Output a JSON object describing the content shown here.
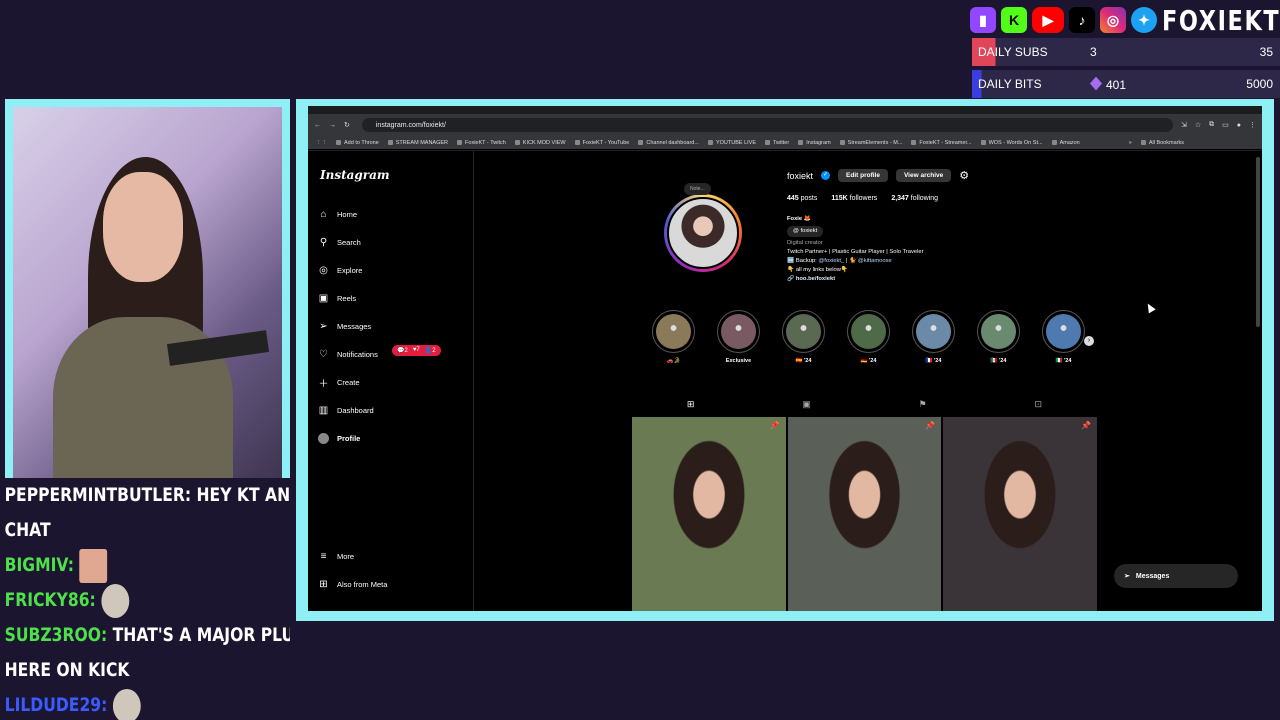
{
  "overlay": {
    "brand": "FOXIEKT",
    "social_icons": [
      "twitch-icon",
      "kick-icon",
      "youtube-icon",
      "tiktok-icon",
      "instagram-icon",
      "twitter-icon"
    ],
    "goals": {
      "subs": {
        "label": "DAILY SUBS",
        "current": "3",
        "target": "35",
        "progress": 0.0857,
        "color": "#e0455a"
      },
      "bits": {
        "label": "DAILY BITS",
        "current": "401",
        "target": "5000",
        "progress": 0.0802,
        "color": "#3c3de0"
      }
    }
  },
  "chat": {
    "lines": [
      {
        "name": "",
        "text": "PEPPERMINTBUTLER: HEY KT AND"
      },
      {
        "name": "",
        "text": "CHAT"
      },
      {
        "name": "BIGMIV:",
        "text": ""
      },
      {
        "name": "FRICKY86:",
        "text": ""
      },
      {
        "name": "SUBZ3ROO:",
        "text": "THAT'S A MAJOR PLUS"
      },
      {
        "name": "",
        "text": "HERE ON KICK"
      },
      {
        "name": "LILDUDE29:",
        "text": ""
      }
    ]
  },
  "browser": {
    "url": "instagram.com/foxiekt/",
    "bookmarks": [
      "Add to Throne",
      "STREAM MANAGER",
      "FoxieKT - Twitch",
      "KICK MOD VIEW",
      "FoxieKT - YouTube",
      "Channel dashboard...",
      "YOUTUBE LIVE",
      "Twitter",
      "Instagram",
      "StreamElements - M...",
      "FoxieKT - Streamer...",
      "WOS - Words On St...",
      "Amazon"
    ],
    "all_bookmarks": "All Bookmarks"
  },
  "instagram": {
    "logo": "Instagram",
    "nav": {
      "home": "Home",
      "search": "Search",
      "explore": "Explore",
      "reels": "Reels",
      "messages": "Messages",
      "notifications": "Notifications",
      "create": "Create",
      "dashboard": "Dashboard",
      "profile": "Profile",
      "more": "More",
      "also_from_meta": "Also from Meta"
    },
    "notif_badge": {
      "comments": "2",
      "likes": "7",
      "follows": "2"
    },
    "profile": {
      "username": "foxiekt",
      "edit_profile": "Edit profile",
      "view_archive": "View archive",
      "note": "Note...",
      "posts": "445",
      "posts_label": "posts",
      "followers": "115K",
      "followers_label": "followers",
      "following": "2,347",
      "following_label": "following",
      "name": "Foxie 🦊",
      "threads_handle": "foxiekt",
      "category": "Digital creator",
      "bio_line1": "Twitch Partner+ | Plastic Guitar Player | Solo Traveler",
      "bio_line2_prefix": "🆕 Backup: ",
      "bio_line2_handle1": "@foxiekt_",
      "bio_line2_mid": " | 🐈 ",
      "bio_line2_handle2": "@kittamoose",
      "bio_line3": "👇 all my links below👇",
      "link": "hoo.be/foxiekt"
    },
    "highlights": [
      {
        "label": "🚗🐊",
        "color": "#8a7a5a"
      },
      {
        "label": "Exclusive",
        "color": "#7a5a62"
      },
      {
        "label": "🇪🇸 '24",
        "color": "#5a6a52"
      },
      {
        "label": "🇩🇪 '24",
        "color": "#4f6a48"
      },
      {
        "label": "🇫🇷 '24",
        "color": "#6a8aa8"
      },
      {
        "label": "🇲🇽 '24",
        "color": "#6a8a70"
      },
      {
        "label": "🇮🇹 '24",
        "color": "#4f7ab0"
      }
    ],
    "tabs": [
      "grid-icon",
      "reels-icon",
      "saved-icon",
      "tagged-icon"
    ],
    "posts": [
      {
        "color": "#6a7a52",
        "pinned": true
      },
      {
        "color": "#5a6058",
        "pinned": true
      },
      {
        "color": "#3a3438",
        "pinned": true
      }
    ],
    "messages_bar": "Messages"
  }
}
